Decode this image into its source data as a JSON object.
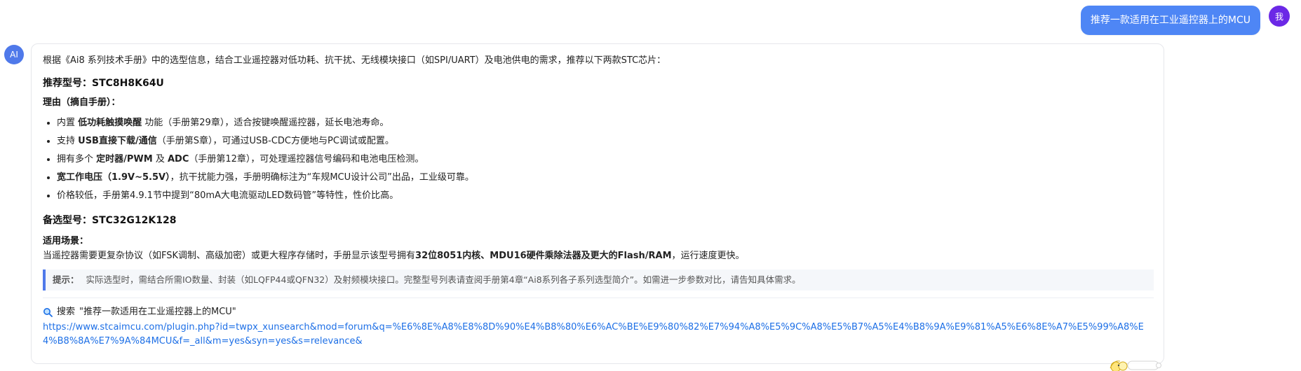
{
  "user": {
    "avatar_label": "我",
    "message": "推荐一款适用在工业遥控器上的MCU"
  },
  "ai": {
    "avatar_label": "AI",
    "intro": "根据《Ai8 系列技术手册》中的选型信息，结合工业遥控器对低功耗、抗干扰、无线模块接口（如SPI/UART）及电池供电的需求，推荐以下两款STC芯片：",
    "primary": {
      "label": "推荐型号：STC8H8K64U",
      "reason_title": "理由（摘自手册）：",
      "reasons": [
        {
          "prefix": "内置 ",
          "strong": "低功耗触摸唤醒",
          "suffix": " 功能（手册第29章），适合按键唤醒遥控器，延长电池寿命。"
        },
        {
          "prefix": "支持 ",
          "strong": "USB直接下载/通信",
          "suffix": "（手册第S章），可通过USB-CDC方便地与PC调试或配置。"
        },
        {
          "prefix": "拥有多个 ",
          "strong": "定时器/PWM",
          "mid": " 及 ",
          "strong2": "ADC",
          "suffix": "（手册第12章），可处理遥控器信号编码和电池电压检测。"
        },
        {
          "prefix": "",
          "strong": "宽工作电压（1.9V~5.5V）",
          "suffix": "，抗干扰能力强，手册明确标注为“车规MCU设计公司”出品，工业级可靠。"
        },
        {
          "prefix": "价格较低，手册第4.9.1节中提到“80mA大电流驱动LED数码管”等特性，性价比高。",
          "strong": "",
          "suffix": ""
        }
      ]
    },
    "alternate": {
      "label": "备选型号：STC32G12K128",
      "usage_title": "适用场景：",
      "usage_text_prefix": "当遥控器需要更复杂协议（如FSK调制、高级加密）或更大程序存储时，手册显示该型号拥有",
      "usage_strong": "32位8051内核、MDU16硬件乘除法器及更大的Flash/RAM",
      "usage_suffix": "，运行速度更快。"
    },
    "tip": {
      "label": "提示：",
      "text": "实际选型时，需结合所需IO数量、封装（如LQFP44或QFN32）及射频模块接口。完整型号列表请查阅手册第4章“Ai8系列各子系列选型简介”。如需进一步参数对比，请告知具体需求。"
    },
    "search": {
      "prefix": "搜索",
      "query": "\"推荐一款适用在工业遥控器上的MCU\"",
      "url": "https://www.stcaimcu.com/plugin.php?id=twpx_xunsearch&mod=forum&q=%E6%8E%A8%E8%8D%90%E4%B8%80%E6%AC%BE%E9%80%82%E7%94%A8%E5%9C%A8%E5%B7%A5%E4%B8%9A%E9%81%A5%E6%8E%A7%E5%99%A8%E4%B8%8A%E7%9A%84MCU&f=_all&m=yes&syn=yes&s=relevance&"
    }
  },
  "colors": {
    "user_bubble": "#4e86f5",
    "user_avatar": "#6b28e6",
    "ai_avatar": "#4f79ea",
    "link": "#1d6fe6",
    "tip_border": "#4f79ea"
  },
  "icons": {
    "search": "search-icon",
    "mascot": "bee-mascot-icon"
  }
}
